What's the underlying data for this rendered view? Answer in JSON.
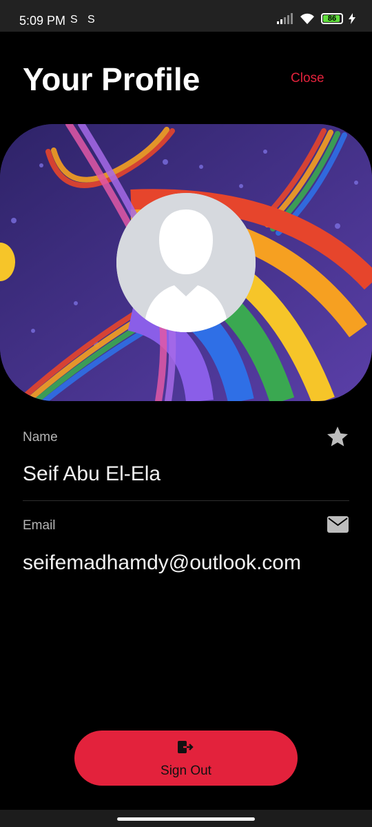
{
  "status_bar": {
    "time": "5:09 PM",
    "notif_icon_1": "S",
    "notif_icon_2": "S",
    "battery_level": "86",
    "icons": [
      "signal-icon",
      "wifi-icon",
      "battery-icon",
      "charging-icon"
    ]
  },
  "header": {
    "title": "Your Profile",
    "close_label": "Close"
  },
  "profile": {
    "banner": "rainbow-banner-image",
    "avatar": "default-avatar-icon"
  },
  "fields": {
    "name_label": "Name",
    "name_value": "Seif Abu El-Ela",
    "name_icon": "star-icon",
    "email_label": "Email",
    "email_value": "seifemadhamdy@outlook.com",
    "email_icon": "mail-icon"
  },
  "actions": {
    "sign_out_label": "Sign Out",
    "sign_out_icon": "logout-icon"
  },
  "colors": {
    "accent": "#e3223c",
    "background": "#000000",
    "label": "#b5b5b5"
  }
}
